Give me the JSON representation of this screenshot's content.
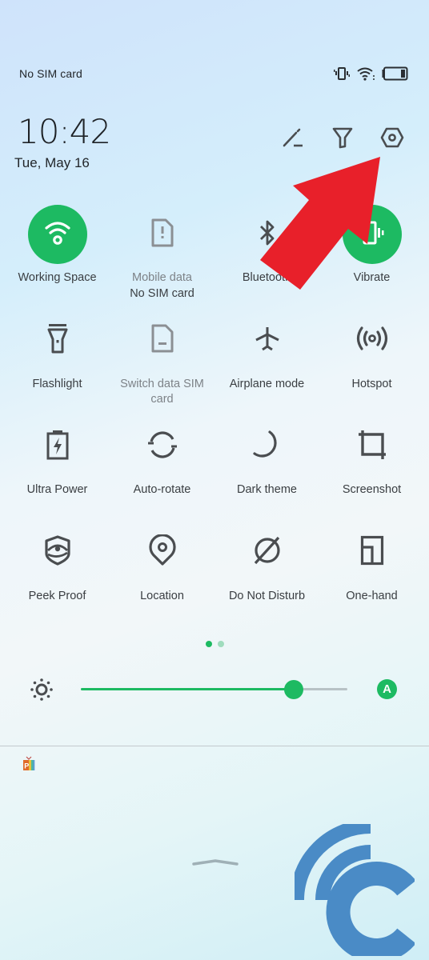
{
  "status_bar": {
    "carrier": "No SIM card",
    "icons": [
      "vibrate-icon",
      "wifi-icon",
      "battery-icon"
    ]
  },
  "header": {
    "time": "10:42",
    "date": "Tue, May 16",
    "actions": [
      {
        "name": "edit-icon",
        "label": "Edit"
      },
      {
        "name": "filter-icon",
        "label": "Notification filter"
      },
      {
        "name": "settings-icon",
        "label": "Settings"
      }
    ]
  },
  "tiles": [
    {
      "id": "wifi",
      "label": "Working Space",
      "icon": "wifi-icon",
      "active": true
    },
    {
      "id": "mobile-data",
      "label": "Mobile data",
      "sub": "No SIM card",
      "icon": "sim-alert-icon",
      "active": false,
      "dimmed": true
    },
    {
      "id": "bluetooth",
      "label": "Bluetooth",
      "icon": "bluetooth-icon",
      "active": false
    },
    {
      "id": "vibrate",
      "label": "Vibrate",
      "icon": "vibrate-icon",
      "active": true
    },
    {
      "id": "flashlight",
      "label": "Flashlight",
      "icon": "flashlight-icon",
      "active": false
    },
    {
      "id": "switch-sim",
      "label": "Switch data SIM card",
      "icon": "sim-card-icon",
      "active": false,
      "dimmed": true
    },
    {
      "id": "airplane",
      "label": "Airplane mode",
      "icon": "airplane-icon",
      "active": false
    },
    {
      "id": "hotspot",
      "label": "Hotspot",
      "icon": "hotspot-icon",
      "active": false
    },
    {
      "id": "ultra-power",
      "label": "Ultra Power",
      "icon": "battery-bolt-icon",
      "active": false
    },
    {
      "id": "auto-rotate",
      "label": "Auto-rotate",
      "icon": "rotate-icon",
      "active": false
    },
    {
      "id": "dark-theme",
      "label": "Dark theme",
      "icon": "moon-icon",
      "active": false
    },
    {
      "id": "screenshot",
      "label": "Screenshot",
      "icon": "crop-icon",
      "active": false
    },
    {
      "id": "peek-proof",
      "label": "Peek Proof",
      "icon": "shield-eye-icon",
      "active": false
    },
    {
      "id": "location",
      "label": "Location",
      "icon": "location-pin-icon",
      "active": false
    },
    {
      "id": "dnd",
      "label": "Do Not Disturb",
      "icon": "do-not-disturb-icon",
      "active": false
    },
    {
      "id": "one-hand",
      "label": "One-hand",
      "icon": "one-hand-icon",
      "active": false
    }
  ],
  "pagination": {
    "current": 1,
    "total": 2
  },
  "brightness": {
    "level_percent": 80,
    "auto_label": "A",
    "auto_enabled": true
  },
  "notifications": [
    {
      "app_icon": "podcast-app-icon"
    }
  ],
  "colors": {
    "accent": "#1dba62",
    "icon": "#4a4d50",
    "icon_dim": "#8b8f93",
    "annotation_arrow": "#e8202a",
    "watermark": "#4a8bc6"
  },
  "annotation": {
    "type": "arrow",
    "points_to": "settings-icon"
  }
}
